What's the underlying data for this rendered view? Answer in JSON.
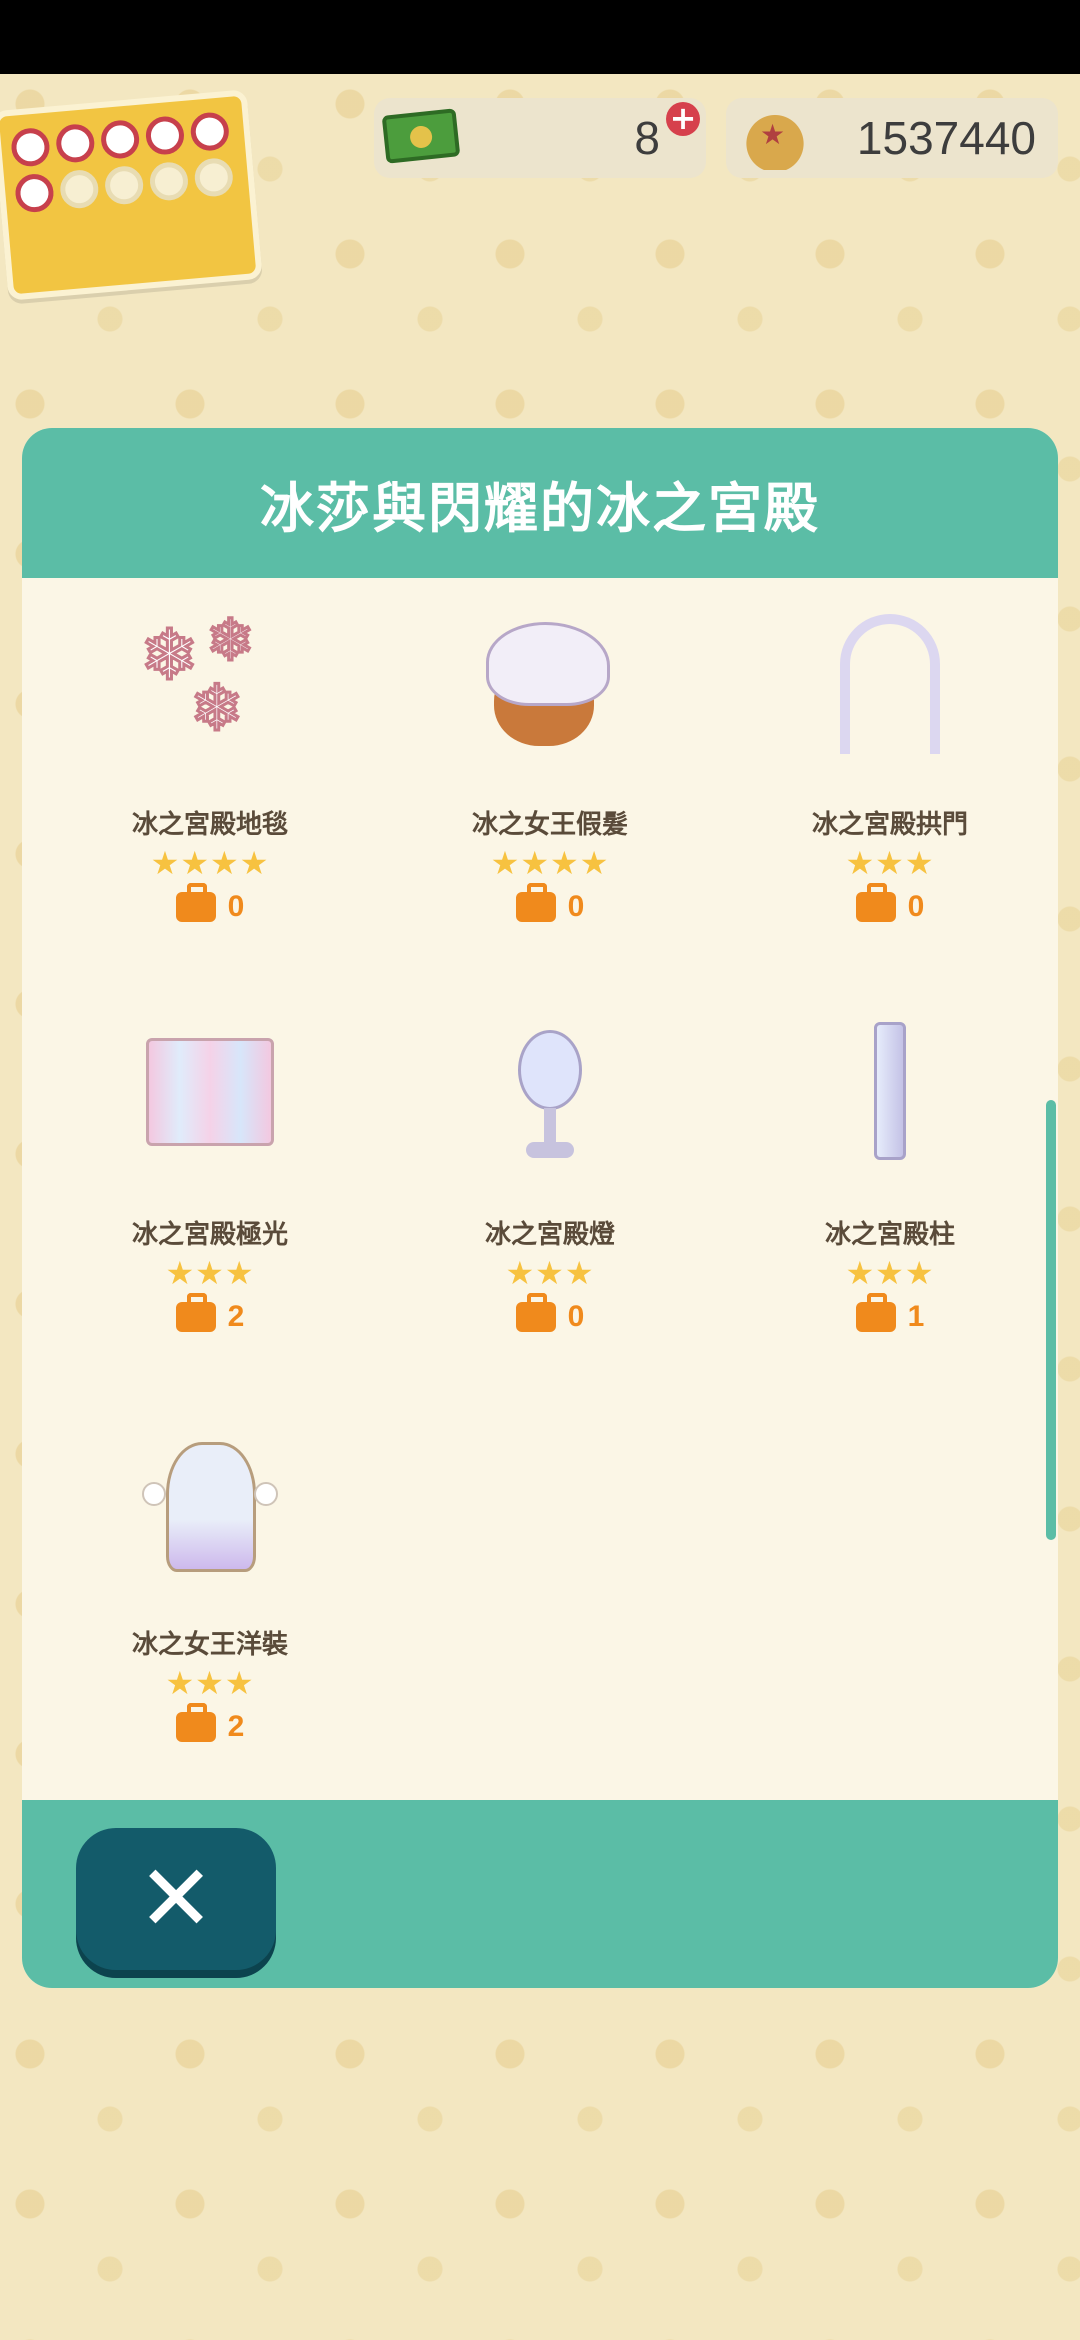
{
  "hud": {
    "ticket_count": "8",
    "bells": "1537440"
  },
  "modal": {
    "title": "冰莎與閃耀的冰之宮殿",
    "items": [
      {
        "name": "冰之宮殿地毯",
        "stars": "★★★★",
        "rarity": 4,
        "owned": "0",
        "icon": "snowflake-rug-icon"
      },
      {
        "name": "冰之女王假髮",
        "stars": "★★★★",
        "rarity": 4,
        "owned": "0",
        "icon": "wig-icon"
      },
      {
        "name": "冰之宮殿拱門",
        "stars": "★★★",
        "rarity": 3,
        "owned": "0",
        "icon": "arch-icon"
      },
      {
        "name": "冰之宮殿極光",
        "stars": "★★★",
        "rarity": 3,
        "owned": "2",
        "icon": "aurora-curtain-icon"
      },
      {
        "name": "冰之宮殿燈",
        "stars": "★★★",
        "rarity": 3,
        "owned": "0",
        "icon": "lamp-icon"
      },
      {
        "name": "冰之宮殿柱",
        "stars": "★★★",
        "rarity": 3,
        "owned": "1",
        "icon": "pillar-icon"
      },
      {
        "name": "冰之女王洋裝",
        "stars": "★★★",
        "rarity": 3,
        "owned": "2",
        "icon": "dress-icon"
      }
    ],
    "close_icon": "✕"
  },
  "colors": {
    "header": "#5bbda6",
    "panel": "#fbf6e6",
    "star": "#f7c240",
    "count": "#f08a1c",
    "close_button": "#135b6a"
  }
}
